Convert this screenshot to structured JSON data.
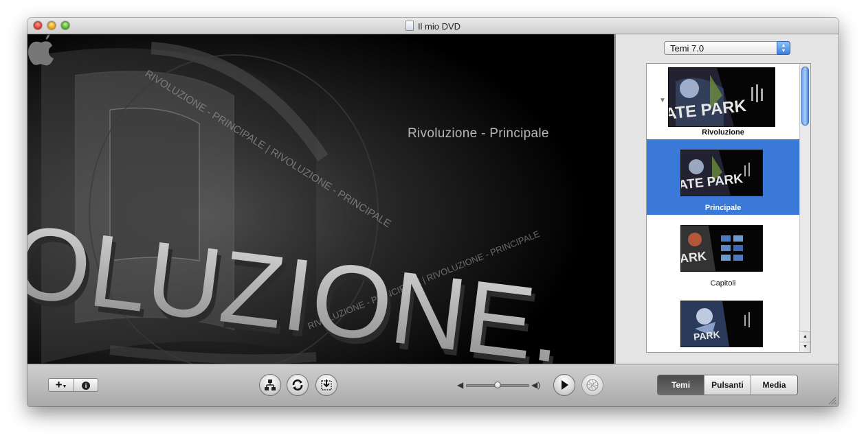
{
  "window": {
    "title": "Il mio DVD"
  },
  "preview": {
    "menu_title": "Rivoluzione - Principale",
    "big_word": "OLUZIONE.",
    "ring_text": "RIVOLUZIONE - PRINCIPALE | RIVOLUZIONE - PRINCIPALE |"
  },
  "theme_panel": {
    "theme_set": "Temi 7.0",
    "items": [
      {
        "label": "Rivoluzione",
        "selected": false,
        "thumb_text": "ATE PARK"
      },
      {
        "label": "Principale",
        "selected": true,
        "thumb_text": "ATE PARK"
      },
      {
        "label": "Capitoli",
        "selected": false,
        "thumb_text": "ARK"
      },
      {
        "label": "",
        "selected": false,
        "thumb_text": "PARK"
      }
    ]
  },
  "toolbar": {
    "add_label": "+",
    "info_label": "i",
    "volume_level": 0.5,
    "tabs": [
      {
        "label": "Temi",
        "active": true
      },
      {
        "label": "Pulsanti",
        "active": false
      },
      {
        "label": "Media",
        "active": false
      }
    ]
  },
  "icons": [
    "map-icon",
    "loop-icon",
    "drop-zone-icon",
    "volume-low-icon",
    "volume-high-icon",
    "play-icon",
    "burn-icon",
    "apple-logo-icon"
  ]
}
